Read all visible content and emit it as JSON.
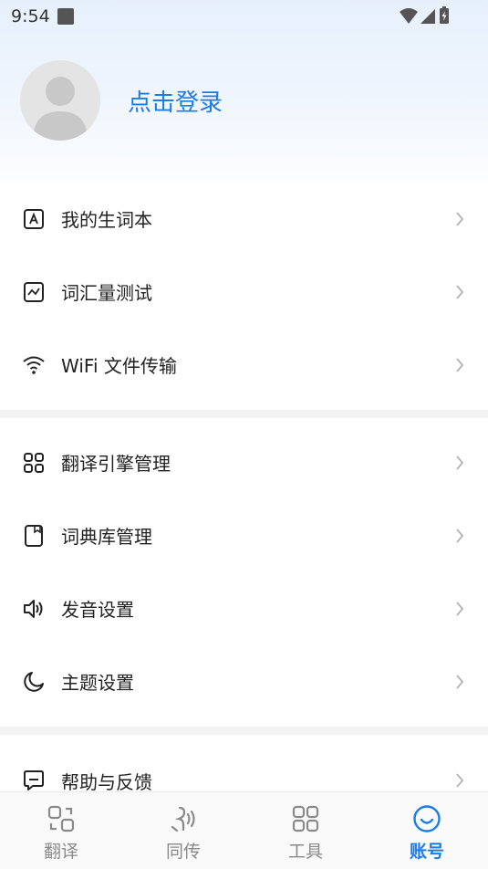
{
  "status_bar": {
    "time": "9:54",
    "icons": [
      "wifi-icon",
      "signal-icon",
      "battery-icon"
    ]
  },
  "profile": {
    "login_label": "点击登录"
  },
  "menu": {
    "group1": [
      {
        "label": "我的生词本",
        "icon": "vocab-book-icon"
      },
      {
        "label": "词汇量测试",
        "icon": "chart-icon"
      },
      {
        "label": "WiFi 文件传输",
        "icon": "wifi-icon"
      }
    ],
    "group2": [
      {
        "label": "翻译引擎管理",
        "icon": "grid-icon"
      },
      {
        "label": "词典库管理",
        "icon": "dictionary-icon"
      },
      {
        "label": "发音设置",
        "icon": "speaker-icon"
      },
      {
        "label": "主题设置",
        "icon": "moon-icon"
      }
    ],
    "group3": [
      {
        "label": "帮助与反馈",
        "icon": "feedback-icon"
      }
    ]
  },
  "bottom_nav": {
    "items": [
      {
        "label": "翻译",
        "icon": "translate-icon"
      },
      {
        "label": "同传",
        "icon": "simultaneous-icon"
      },
      {
        "label": "工具",
        "icon": "tools-icon"
      },
      {
        "label": "账号",
        "icon": "account-icon",
        "active": true
      }
    ]
  },
  "colors": {
    "accent": "#1a7ce6",
    "inactive": "#8a8a8a"
  }
}
